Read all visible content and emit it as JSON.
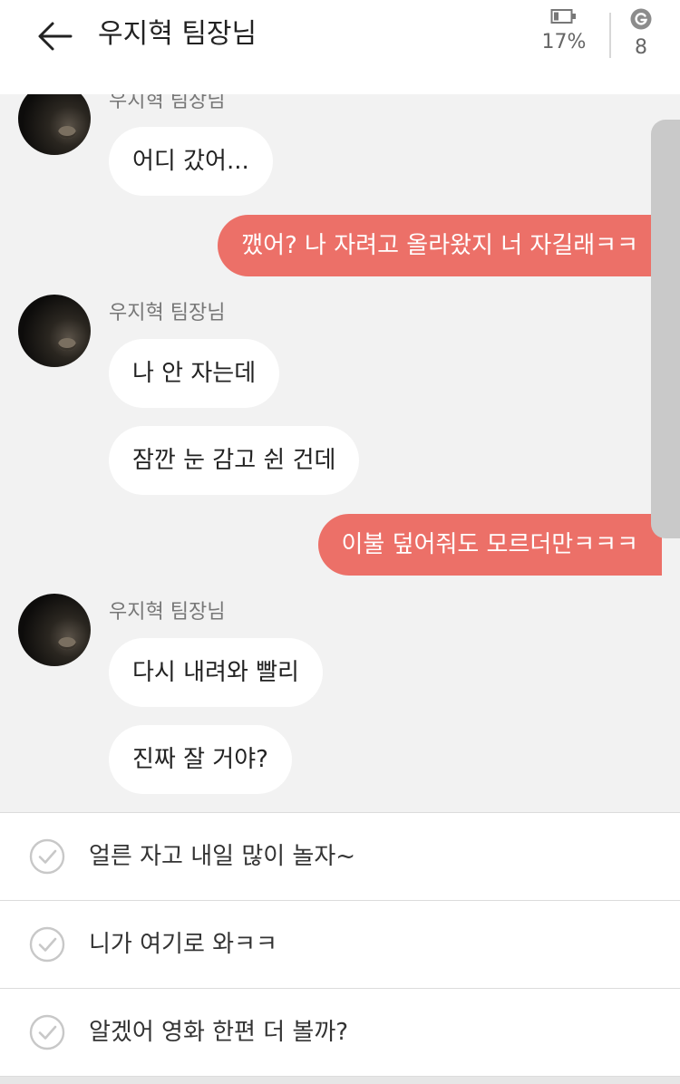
{
  "header": {
    "title": "우지혁 팀장님",
    "battery_text": "17%",
    "g_count": "8"
  },
  "chat": {
    "messages": [
      {
        "type": "in",
        "sender": "우지혁 팀장님",
        "text": "어디 갔어..."
      },
      {
        "type": "out",
        "text": "깼어? 나 자려고 올라왔지 너 자길래ㅋㅋ"
      },
      {
        "type": "in",
        "sender": "우지혁 팀장님",
        "text": "나 안 자는데"
      },
      {
        "type": "in",
        "text": "잠깐 눈 감고 쉰 건데"
      },
      {
        "type": "out",
        "text": "이불 덮어줘도 모르더만ㅋㅋㅋ"
      },
      {
        "type": "in",
        "sender": "우지혁 팀장님",
        "text": "다시 내려와 빨리"
      },
      {
        "type": "in",
        "text": "진짜 잘 거야?"
      }
    ]
  },
  "suggestions": [
    {
      "text": "얼른 자고 내일 많이 놀자~"
    },
    {
      "text": "니가 여기로 와ㅋㅋ"
    },
    {
      "text": "알겠어 영화 한편 더 볼까?"
    }
  ],
  "icons": {
    "back": "arrow-left-icon",
    "battery": "battery-icon",
    "g": "g-coin-icon",
    "check": "check-circle-icon"
  },
  "colors": {
    "accent": "#ec7068",
    "background": "#f2f2f2",
    "bubble_in": "#ffffff"
  }
}
